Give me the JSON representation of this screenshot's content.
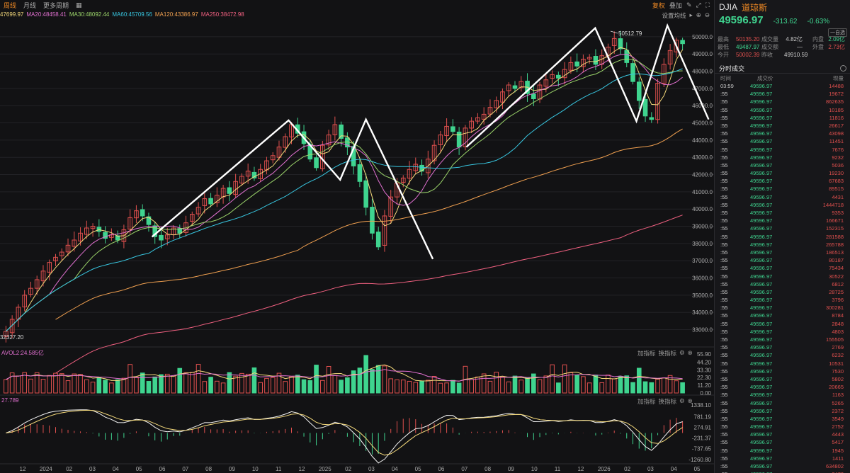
{
  "toolbar": {
    "timeframes": [
      "周线",
      "月线",
      "更多周期"
    ],
    "active_timeframe": 0,
    "right": {
      "fuquan": "复权",
      "overlay": "叠加"
    },
    "settings": "设置均线"
  },
  "ma_legend": [
    {
      "text": "47699.97",
      "color": "#f4d97b"
    },
    {
      "text": "MA20:48458.41",
      "color": "#e070d0"
    },
    {
      "text": "MA30:48092.44",
      "color": "#9bd46a"
    },
    {
      "text": "MA60:45709.56",
      "color": "#38c6e0"
    },
    {
      "text": "MA120:43386.97",
      "color": "#f0a050"
    },
    {
      "text": "MA250:38472.98",
      "color": "#f06080"
    }
  ],
  "price_axis": [
    "50000.0",
    "49000.0",
    "48000.0",
    "47000.0",
    "46000.0",
    "45000.0",
    "44000.0",
    "43000.0",
    "42000.0",
    "41000.0",
    "40000.0",
    "39000.0",
    "38000.0",
    "37000.0",
    "36000.0",
    "35000.0",
    "34000.0",
    "33000.0"
  ],
  "price_high_label": "50512.79",
  "price_low_label": "32327.20",
  "volume_pane": {
    "label": "AVOL2:24.585亿",
    "tools": [
      "加指标",
      "换指标"
    ],
    "axis": [
      "55.90",
      "44.20",
      "33.30",
      "22.30",
      "11.20",
      "0.00"
    ]
  },
  "macd_pane": {
    "label": "27.789",
    "tools": [
      "加指标",
      "换指标"
    ],
    "axis": [
      "1338.10",
      "781.19",
      "274.91",
      "-231.37",
      "-737.65",
      "-1260.80"
    ]
  },
  "time_axis": [
    "12",
    "2024",
    "02",
    "03",
    "04",
    "05",
    "06",
    "07",
    "08",
    "09",
    "10",
    "11",
    "12",
    "2025",
    "02",
    "03",
    "04",
    "05",
    "06",
    "07",
    "08",
    "09",
    "10",
    "11",
    "12",
    "2026",
    "02",
    "03",
    "04",
    "05"
  ],
  "chart_data": {
    "type": "candlestick",
    "title": "",
    "price_range": [
      32327.2,
      50512.79
    ],
    "grid": true,
    "close_points": [
      32900,
      33600,
      34300,
      35000,
      35400,
      35900,
      36400,
      36900,
      37200,
      37500,
      37900,
      38200,
      38600,
      38900,
      39000,
      38700,
      38300,
      38500,
      38200,
      38800,
      39500,
      39900,
      39600,
      39100,
      38400,
      38200,
      38500,
      38900,
      38600,
      39200,
      39700,
      40100,
      40600,
      40300,
      40800,
      41200,
      40900,
      41600,
      41900,
      42200,
      41800,
      42300,
      42800,
      43100,
      43600,
      44200,
      44900,
      44400,
      43800,
      42900,
      42400,
      43700,
      44300,
      44900,
      44100,
      43600,
      42500,
      41600,
      40100,
      38600,
      37800,
      39600,
      40700,
      41500,
      41800,
      42300,
      42600,
      42200,
      42900,
      43700,
      44300,
      44800,
      44500,
      43600,
      44700,
      45100,
      45300,
      45500,
      45900,
      46300,
      46800,
      47200,
      47000,
      47400,
      46700,
      46400,
      47200,
      47500,
      47800,
      47600,
      48100,
      48500,
      48300,
      48700,
      48800,
      48400,
      48900,
      49400,
      49900,
      49300,
      48500,
      47400,
      46300,
      45400,
      45200,
      47300,
      48400,
      49200,
      49800,
      49597
    ],
    "ma_series": [
      {
        "name": "MA20",
        "color": "#e070d0"
      },
      {
        "name": "MA30",
        "color": "#9bd46a"
      },
      {
        "name": "MA60",
        "color": "#38c6e0"
      },
      {
        "name": "MA120",
        "color": "#f0a050"
      },
      {
        "name": "MA250",
        "color": "#f06080"
      }
    ],
    "annotation_lines": [
      [
        [
          2024.39,
          38390
        ],
        [
          2024.92,
          45150
        ],
        [
          2025.12,
          41700
        ],
        [
          2025.22,
          45200
        ],
        [
          2025.48,
          37100
        ]
      ],
      [
        [
          2025.61,
          43600
        ],
        [
          2026.11,
          50500
        ],
        [
          2026.27,
          45100
        ],
        [
          2026.39,
          50650
        ],
        [
          2026.55,
          45200
        ]
      ]
    ]
  },
  "quote": {
    "symbol": "DJIA",
    "name": "道琼斯",
    "price": "49596.97",
    "change": "-313.62",
    "change_pct": "-0.63%",
    "toggle": "一自选",
    "rows": [
      {
        "k1": "最高",
        "v1": "50135.20",
        "k2": "成交量",
        "v2": "4.82亿",
        "k3": "内盘",
        "v3": "2.09亿",
        "c1": "red",
        "c3": "green"
      },
      {
        "k1": "最低",
        "v1": "49487.97",
        "k2": "成交额",
        "v2": "—",
        "k3": "外盘",
        "v3": "2.73亿",
        "c1": "green",
        "c3": "red"
      },
      {
        "k1": "今开",
        "v1": "50002.39",
        "k2": "昨收",
        "v2": "49910.59",
        "k3": "",
        "v3": "",
        "c1": "red",
        "c3": "green"
      }
    ]
  },
  "ticks_panel": {
    "title": "分时成交",
    "headers": [
      "时间",
      "成交价",
      "现量"
    ],
    "rows": [
      {
        "t": "03:59",
        "p": "49596.97",
        "v": "14488",
        "c": "red"
      },
      {
        "t": ":55",
        "p": "49596.97",
        "v": "19672",
        "c": "red"
      },
      {
        "t": ":55",
        "p": "49596.97",
        "v": "862635",
        "c": "red"
      },
      {
        "t": ":55",
        "p": "49596.97",
        "v": "10185",
        "c": "red"
      },
      {
        "t": ":55",
        "p": "49596.97",
        "v": "11816",
        "c": "red"
      },
      {
        "t": ":55",
        "p": "49596.97",
        "v": "26617",
        "c": "red"
      },
      {
        "t": ":55",
        "p": "49596.97",
        "v": "43098",
        "c": "red"
      },
      {
        "t": ":55",
        "p": "49596.97",
        "v": "11451",
        "c": "red"
      },
      {
        "t": ":55",
        "p": "49596.97",
        "v": "7676",
        "c": "red"
      },
      {
        "t": ":55",
        "p": "49596.97",
        "v": "9232",
        "c": "red"
      },
      {
        "t": ":55",
        "p": "49596.97",
        "v": "5036",
        "c": "red"
      },
      {
        "t": ":55",
        "p": "49596.97",
        "v": "19230",
        "c": "red"
      },
      {
        "t": ":55",
        "p": "49596.97",
        "v": "67683",
        "c": "red"
      },
      {
        "t": ":55",
        "p": "49596.97",
        "v": "89515",
        "c": "red"
      },
      {
        "t": ":55",
        "p": "49596.97",
        "v": "4431",
        "c": "red"
      },
      {
        "t": ":55",
        "p": "49596.97",
        "v": "1444718",
        "c": "red"
      },
      {
        "t": ":55",
        "p": "49596.97",
        "v": "9353",
        "c": "red"
      },
      {
        "t": ":55",
        "p": "49596.97",
        "v": "166671",
        "c": "red"
      },
      {
        "t": ":55",
        "p": "49596.97",
        "v": "152315",
        "c": "red"
      },
      {
        "t": ":55",
        "p": "49596.97",
        "v": "281588",
        "c": "red"
      },
      {
        "t": ":55",
        "p": "49596.97",
        "v": "265788",
        "c": "red"
      },
      {
        "t": ":55",
        "p": "49596.97",
        "v": "186513",
        "c": "red"
      },
      {
        "t": ":55",
        "p": "49596.97",
        "v": "80187",
        "c": "red"
      },
      {
        "t": ":55",
        "p": "49596.97",
        "v": "75434",
        "c": "red"
      },
      {
        "t": ":55",
        "p": "49596.97",
        "v": "30522",
        "c": "red"
      },
      {
        "t": ":55",
        "p": "49596.97",
        "v": "6812",
        "c": "red"
      },
      {
        "t": ":55",
        "p": "49596.97",
        "v": "28725",
        "c": "red"
      },
      {
        "t": ":55",
        "p": "49596.97",
        "v": "3796",
        "c": "red"
      },
      {
        "t": ":55",
        "p": "49596.97",
        "v": "300281",
        "c": "red"
      },
      {
        "t": ":55",
        "p": "49596.97",
        "v": "8784",
        "c": "red"
      },
      {
        "t": ":55",
        "p": "49596.97",
        "v": "2848",
        "c": "red"
      },
      {
        "t": ":55",
        "p": "49596.97",
        "v": "4803",
        "c": "red"
      },
      {
        "t": ":55",
        "p": "49596.97",
        "v": "155505",
        "c": "red"
      },
      {
        "t": ":55",
        "p": "49596.97",
        "v": "2769",
        "c": "red"
      },
      {
        "t": ":55",
        "p": "49596.97",
        "v": "6232",
        "c": "red"
      },
      {
        "t": ":55",
        "p": "49596.97",
        "v": "10531",
        "c": "red"
      },
      {
        "t": ":55",
        "p": "49596.97",
        "v": "7530",
        "c": "red"
      },
      {
        "t": ":55",
        "p": "49596.97",
        "v": "5802",
        "c": "red"
      },
      {
        "t": ":55",
        "p": "49596.97",
        "v": "20665",
        "c": "red"
      },
      {
        "t": ":55",
        "p": "49596.97",
        "v": "1163",
        "c": "red"
      },
      {
        "t": ":55",
        "p": "49596.97",
        "v": "5265",
        "c": "red"
      },
      {
        "t": ":55",
        "p": "49596.97",
        "v": "2372",
        "c": "red"
      },
      {
        "t": ":55",
        "p": "49596.97",
        "v": "3549",
        "c": "red"
      },
      {
        "t": ":55",
        "p": "49596.97",
        "v": "2752",
        "c": "red"
      },
      {
        "t": ":55",
        "p": "49596.97",
        "v": "4443",
        "c": "red"
      },
      {
        "t": ":55",
        "p": "49596.97",
        "v": "5417",
        "c": "red"
      },
      {
        "t": ":55",
        "p": "49596.97",
        "v": "1945",
        "c": "red"
      },
      {
        "t": ":55",
        "p": "49596.97",
        "v": "1411",
        "c": "red"
      },
      {
        "t": ":55",
        "p": "49596.97",
        "v": "634802",
        "c": "red"
      },
      {
        "t": ":55",
        "p": "49596.97",
        "v": "3472",
        "c": "red"
      }
    ]
  },
  "colors": {
    "up": "#e0504e",
    "down": "#3fd48f",
    "accent": "#f08a24",
    "bg": "#121214"
  }
}
